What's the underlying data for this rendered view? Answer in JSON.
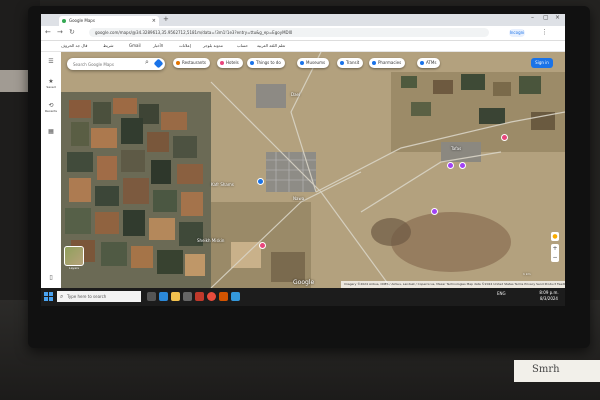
{
  "browser": {
    "tab_title": "Google Maps",
    "url": "google.com/maps/@34.3289613,35.9562712,5181m/data=!3m1!1e3?entry=ttu&g_ep=EgoyMDI0",
    "incognito_label": "Incogni",
    "bookmarks": [
      "قال جد الحروف",
      "شريط",
      "Gmail",
      "الأخبار",
      "إعلانات",
      "مدونة بلوجر",
      "حساب",
      "تعلم اللغة العربية"
    ]
  },
  "maps": {
    "search_placeholder": "Search Google Maps",
    "chips": [
      {
        "label": "Restaurants",
        "color": "#e37400"
      },
      {
        "label": "Hotels",
        "color": "#e8467c"
      },
      {
        "label": "Things to do",
        "color": "#1a73e8"
      },
      {
        "label": "Museums",
        "color": "#1a73e8"
      },
      {
        "label": "Transit",
        "color": "#1a73e8"
      },
      {
        "label": "Pharmacies",
        "color": "#1a73e8"
      },
      {
        "label": "ATMs",
        "color": "#1a73e8"
      }
    ],
    "signin_label": "Sign in",
    "rail": [
      {
        "icon": "☰",
        "label": ""
      },
      {
        "icon": "★",
        "label": "Saved"
      },
      {
        "icon": "⟲",
        "label": "Recents"
      },
      {
        "icon": "▦",
        "label": ""
      }
    ],
    "layers_label": "Layers",
    "place_labels": [
      "Kafr Shams",
      "Nawa",
      "Sheikh Miskin",
      "Tafas",
      "Dael"
    ],
    "google_logo": "Google",
    "legal_text": "Imagery ©2024 Airbus, CNES / Airbus, Landsat / Copernicus, Maxar Technologies  Map data ©2024  United States  Terms  Privacy  Send Product Feedback  1 km",
    "scale_label": "1 km"
  },
  "taskbar": {
    "search_placeholder": "Type here to search",
    "time": "8:09 p.m.",
    "date": "8/3/2024",
    "tray_text": "ENG"
  },
  "sticker_text": "Smrh"
}
